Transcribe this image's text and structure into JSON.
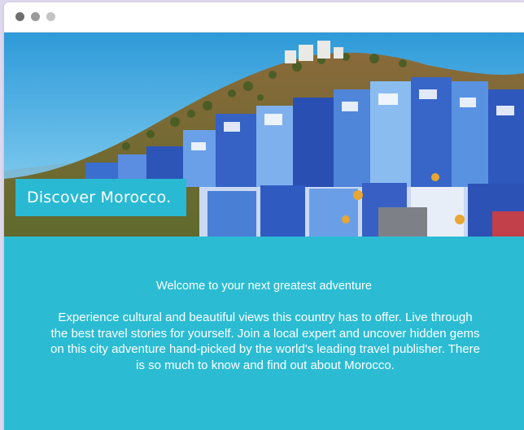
{
  "hero": {
    "badge_text": "Discover Morocco."
  },
  "content": {
    "heading": "Welcome to your next greatest adventure",
    "body": "Experience cultural and beautiful views this country has to offer. Live through the best travel stories for yourself. Join a local expert and uncover hidden gems on this city adventure hand-picked by the world's leading travel publisher. There is so much to know and find out about Morocco."
  },
  "colors": {
    "accent": "#2bbcd4",
    "background": "#ddd8ee"
  }
}
